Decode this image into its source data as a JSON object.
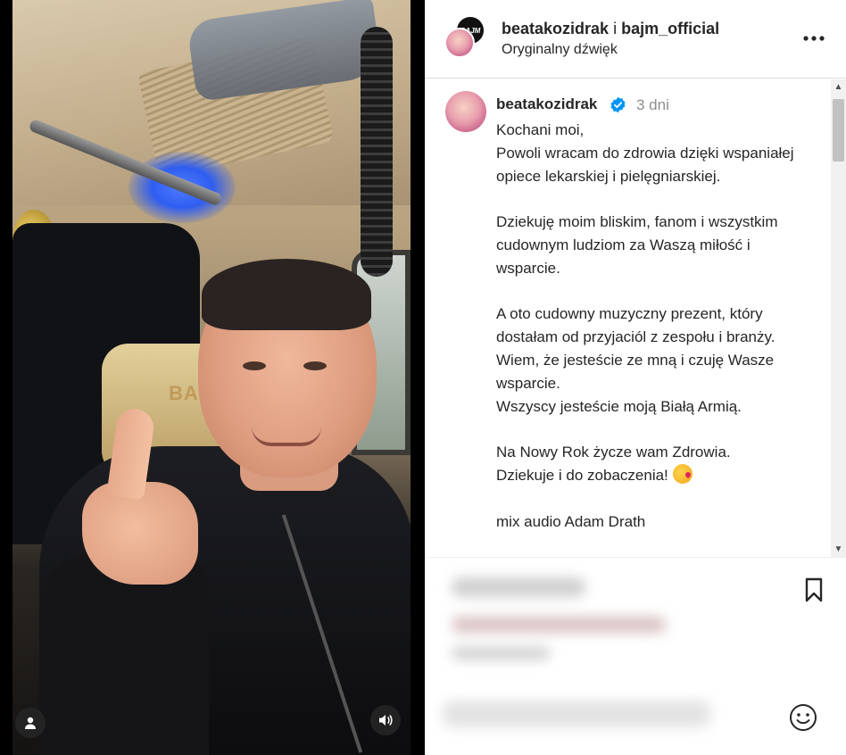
{
  "media": {
    "headrest_text": "BAJM"
  },
  "header": {
    "user_primary": "beatakozidrak",
    "separator": " i ",
    "user_secondary": "bajm_official",
    "audio": "Oryginalny dźwięk",
    "secondary_avatar_text": "BAJM"
  },
  "post": {
    "username": "beatakozidrak",
    "time": "3 dni",
    "caption_main": "Kochani moi,\nPowoli wracam do zdrowia dzięki wspaniałej opiece lekarskiej i pielęgniarskiej.\n\nDziekuję moim bliskim, fanom i wszystkim cudownym ludziom za Waszą miłość i wsparcie.\n\nA oto cudowny muzyczny prezent, który dostałam od przyjaciól z zespołu i branży. Wiem, że jesteście ze mną i czuję Wasze wsparcie.\nWszyscy jesteście moją Białą Armią.\n\nNa Nowy Rok życze wam Zdrowia.\nDziekuje i do zobaczenia! ",
    "caption_tail": "\n\nmix audio Adam Drath"
  },
  "icons": {
    "more": "more-options-icon",
    "verified": "verified-badge-icon",
    "bookmark": "bookmark-icon",
    "emoji": "emoji-icon",
    "user": "user-tag-icon",
    "sound": "sound-icon"
  },
  "colors": {
    "verified": "#0095f6",
    "text": "#262626",
    "muted": "#8e8e8e"
  }
}
